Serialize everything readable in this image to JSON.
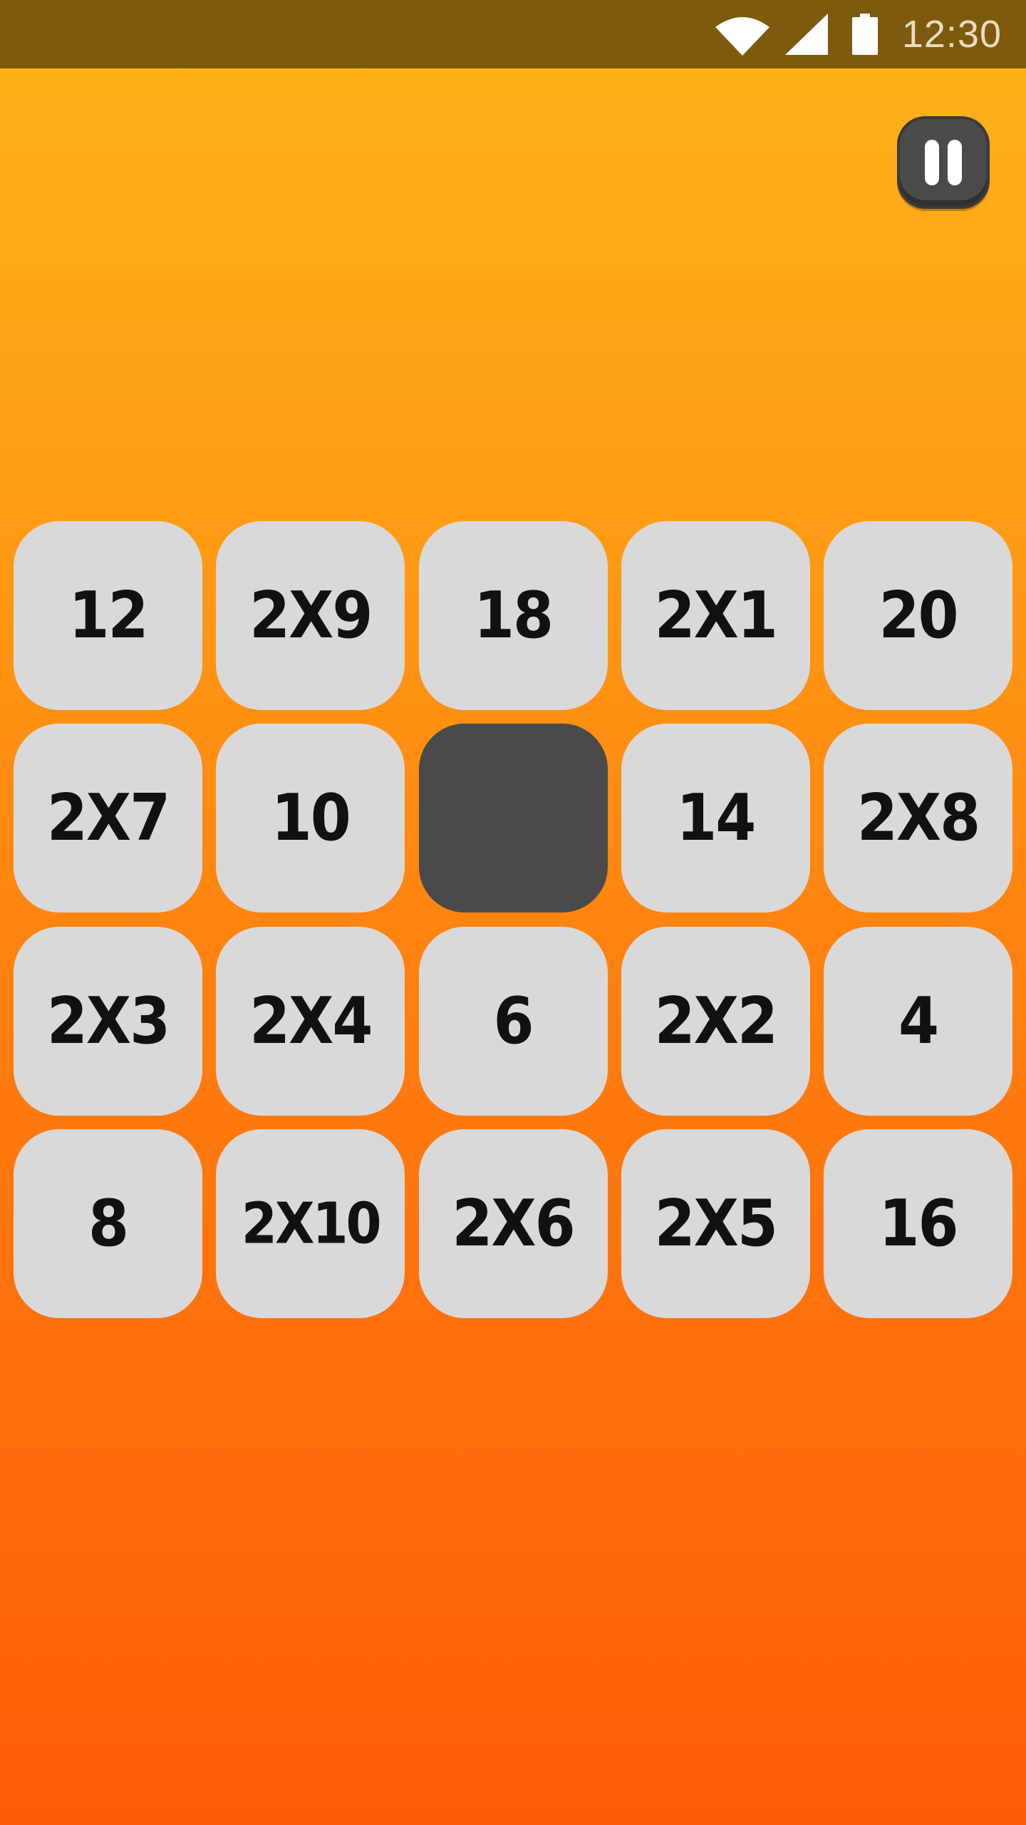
{
  "status_bar": {
    "time": "12:30",
    "icons": [
      "wifi-icon",
      "signal-icon",
      "battery-icon"
    ],
    "background": "#7E5A0E"
  },
  "controls": {
    "pause_icon": "pause-icon"
  },
  "board": {
    "rows": 4,
    "cols": 5,
    "tiles": [
      [
        "12",
        "2X9",
        "18",
        "2X1",
        "20"
      ],
      [
        "2X7",
        "10",
        "",
        "14",
        "2X8"
      ],
      [
        "2X3",
        "2X4",
        "6",
        "2X2",
        "4"
      ],
      [
        "8",
        "2X10",
        "2X6",
        "2X5",
        "16"
      ]
    ],
    "empty_position": {
      "row": 1,
      "col": 2
    },
    "tile_color": "#D9D9D9",
    "empty_color": "#4A4A4A"
  }
}
